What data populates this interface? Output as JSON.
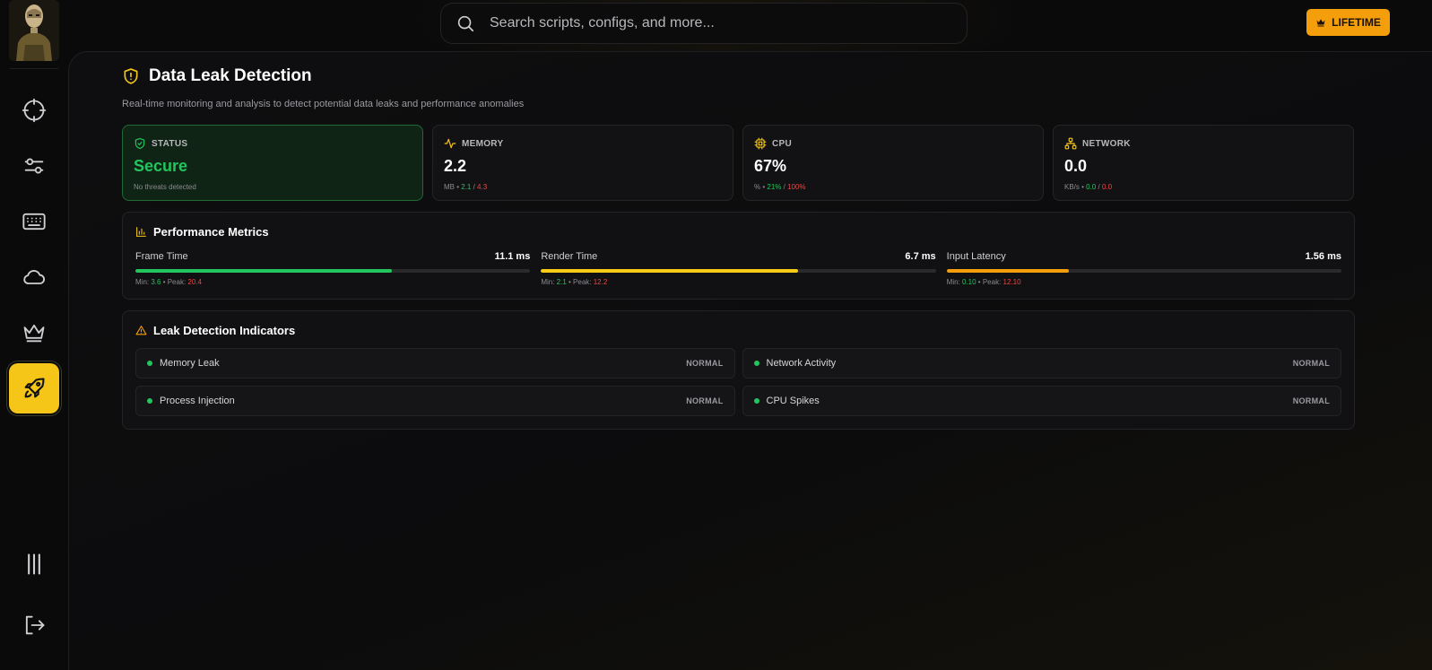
{
  "search": {
    "placeholder": "Search scripts, configs, and more..."
  },
  "header": {
    "badge_label": "LIFETIME"
  },
  "page": {
    "title": "Data Leak Detection",
    "subtitle": "Real-time monitoring and analysis to detect potential data leaks and performance anomalies"
  },
  "cards": {
    "status": {
      "label": "STATUS",
      "value": "Secure",
      "sub": "No threats detected"
    },
    "memory": {
      "label": "MEMORY",
      "value": "2.2",
      "unit": "MB",
      "min": "2.1",
      "max": "4.3"
    },
    "cpu": {
      "label": "CPU",
      "value": "67%",
      "unit": "%",
      "min": "21%",
      "max": "100%"
    },
    "network": {
      "label": "NETWORK",
      "value": "0.0",
      "unit": "KB/s",
      "min": "0.0",
      "max": "0.0"
    }
  },
  "performance": {
    "title": "Performance Metrics",
    "metrics": [
      {
        "label": "Frame Time",
        "value": "11.1 ms",
        "min": "3.6",
        "peak": "20.4",
        "fill": 0.65,
        "color": "#22c55e"
      },
      {
        "label": "Render Time",
        "value": "6.7 ms",
        "min": "2.1",
        "peak": "12.2",
        "fill": 0.65,
        "color": "#facc15"
      },
      {
        "label": "Input Latency",
        "value": "1.56 ms",
        "min": "0.10",
        "peak": "12.10",
        "fill": 0.31,
        "color": "#f59e0b"
      }
    ],
    "min_prefix": "Min: ",
    "peak_prefix": "Peak: "
  },
  "leak": {
    "title": "Leak Detection Indicators",
    "items": [
      {
        "label": "Memory Leak",
        "status": "NORMAL"
      },
      {
        "label": "Network Activity",
        "status": "NORMAL"
      },
      {
        "label": "Process Injection",
        "status": "NORMAL"
      },
      {
        "label": "CPU Spikes",
        "status": "NORMAL"
      }
    ]
  },
  "colors": {
    "accent": "#f5c518",
    "success": "#22c55e",
    "danger": "#ef4444",
    "badge": "#f59e0b"
  },
  "icons": {
    "sidebar": [
      "crosshair-icon",
      "sliders-icon",
      "keyboard-icon",
      "cloud-icon",
      "crown-icon",
      "rocket-icon"
    ],
    "sidebar_bottom": [
      "columns-icon",
      "logout-icon"
    ]
  }
}
